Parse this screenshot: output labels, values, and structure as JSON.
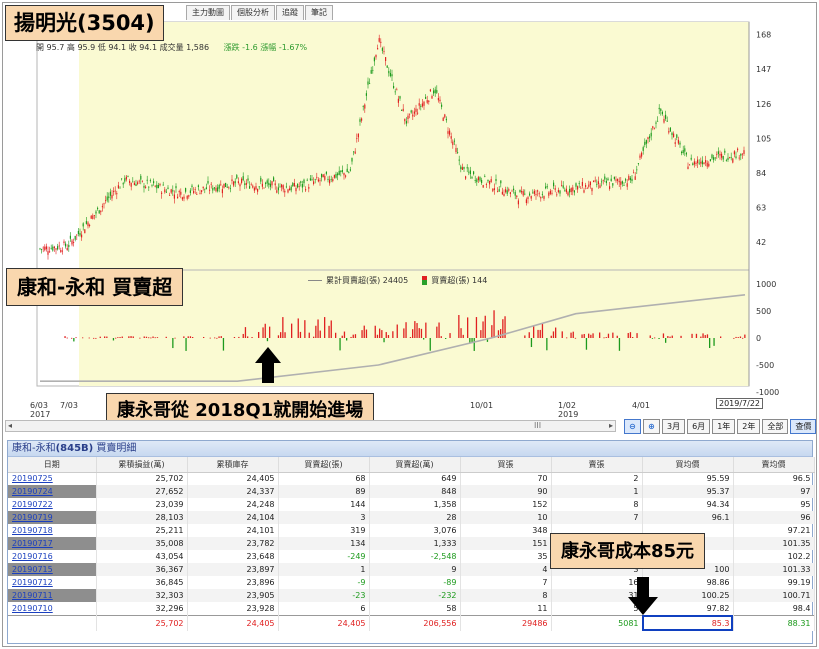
{
  "title_callout": "揚明光(3504)",
  "tabs": [
    "主力動圖",
    "個股分析",
    "追蹤",
    "筆記"
  ],
  "price_info": {
    "quote": "開 95.7 高 95.9 低 94.1 收 94.1 成交量 1,586",
    "change": "漲跌 -1.6 漲幅 -1.67%"
  },
  "broker_callout": "康和-永和 買賣超",
  "legend": {
    "cumulative": "累計買賣超(張) 24405",
    "daily": "買賣超(張) 144"
  },
  "start_callout": "康永哥從 2018Q1就開始進場",
  "cost_callout": "康永哥成本85元",
  "cursor_date": "2019/7/22",
  "colors": {
    "up": "#e02020",
    "down": "#1c9a1c",
    "callout": "#f9d7ae",
    "highlight_bg": "#fafad2"
  },
  "x_labels": [
    {
      "line1": "6/03",
      "line2": "2017"
    },
    {
      "line1": "7/03",
      "line2": ""
    },
    {
      "line1": "10/01",
      "line2": ""
    },
    {
      "line1": "1/02",
      "line2": "2019"
    },
    {
      "line1": "4/01",
      "line2": ""
    }
  ],
  "chart_data": [
    {
      "type": "line",
      "title": "",
      "x_range": [
        "2017-06",
        "2019-07"
      ],
      "y_ticks": [
        42,
        63,
        84,
        105,
        126,
        147,
        168
      ],
      "series": [
        {
          "name": "",
          "x": [
            "2017-06",
            "2017-07",
            "2017-09",
            "2017-11",
            "2018-01",
            "2018-03",
            "2018-05",
            "2018-06",
            "2018-07",
            "2018-08",
            "2018-09",
            "2018-11",
            "2019-01",
            "2019-03",
            "2019-04",
            "2019-05",
            "2019-07"
          ],
          "values": [
            38,
            40,
            80,
            72,
            78,
            75,
            85,
            165,
            115,
            135,
            85,
            70,
            75,
            80,
            122,
            90,
            97
          ]
        }
      ]
    },
    {
      "type": "bar",
      "title": "",
      "y_ticks": [
        -1000,
        -500,
        0,
        500,
        1000
      ],
      "series": [
        {
          "name": "累計買賣超(張)",
          "x": [
            "2017-06",
            "2018-01",
            "2018-06",
            "2018-10",
            "2019-01",
            "2019-07"
          ],
          "values": [
            -800,
            -800,
            -500,
            0,
            450,
            800
          ]
        },
        {
          "name": "買賣超(張)",
          "x": [
            "2018-01",
            "2018-03",
            "2018-05",
            "2018-07",
            "2018-10",
            "2019-01",
            "2019-07"
          ],
          "values": [
            300,
            950,
            400,
            500,
            900,
            200,
            144
          ]
        }
      ]
    }
  ],
  "scroll_mark": "III",
  "buttons": [
    "3月",
    "6月",
    "1年",
    "2年",
    "全部",
    "查價"
  ],
  "detail_title": {
    "prefix": "康和-永和",
    "code": "(845B)",
    "suffix": " 買賣明細"
  },
  "table": {
    "headers": [
      "日期",
      "累積損益(萬)",
      "累積庫存",
      "買賣超(張)",
      "買賣超(萬)",
      "買張",
      "賣張",
      "買均價",
      "賣均價"
    ],
    "rows": [
      [
        "20190725",
        "25,702",
        "24,405",
        "68",
        "649",
        "70",
        "2",
        "95.59",
        "96.5"
      ],
      [
        "20190724",
        "27,652",
        "24,337",
        "89",
        "848",
        "90",
        "1",
        "95.37",
        "97"
      ],
      [
        "20190722",
        "23,039",
        "24,248",
        "144",
        "1,358",
        "152",
        "8",
        "94.34",
        "95"
      ],
      [
        "20190719",
        "28,103",
        "24,104",
        "3",
        "28",
        "10",
        "7",
        "96.1",
        "96"
      ],
      [
        "20190718",
        "25,211",
        "24,101",
        "319",
        "3,076",
        "348",
        "",
        "",
        "97.21"
      ],
      [
        "20190717",
        "35,008",
        "23,782",
        "134",
        "1,333",
        "151",
        "",
        "",
        "101.35"
      ],
      [
        "20190716",
        "43,054",
        "23,648",
        "-249",
        "-2,548",
        "35",
        "",
        "",
        "102.2"
      ],
      [
        "20190715",
        "36,367",
        "23,897",
        "1",
        "9",
        "4",
        "3",
        "100",
        "101.33"
      ],
      [
        "20190712",
        "36,845",
        "23,896",
        "-9",
        "-89",
        "7",
        "16",
        "98.86",
        "99.19"
      ],
      [
        "20190711",
        "32,303",
        "23,905",
        "-23",
        "-232",
        "8",
        "31",
        "100.25",
        "100.71"
      ],
      [
        "20190710",
        "32,296",
        "23,928",
        "6",
        "58",
        "11",
        "5",
        "97.82",
        "98.4"
      ]
    ],
    "totals": [
      "",
      "25,702",
      "24,405",
      "24,405",
      "206,556",
      "29486",
      "5081",
      "85.3",
      "88.31"
    ]
  }
}
